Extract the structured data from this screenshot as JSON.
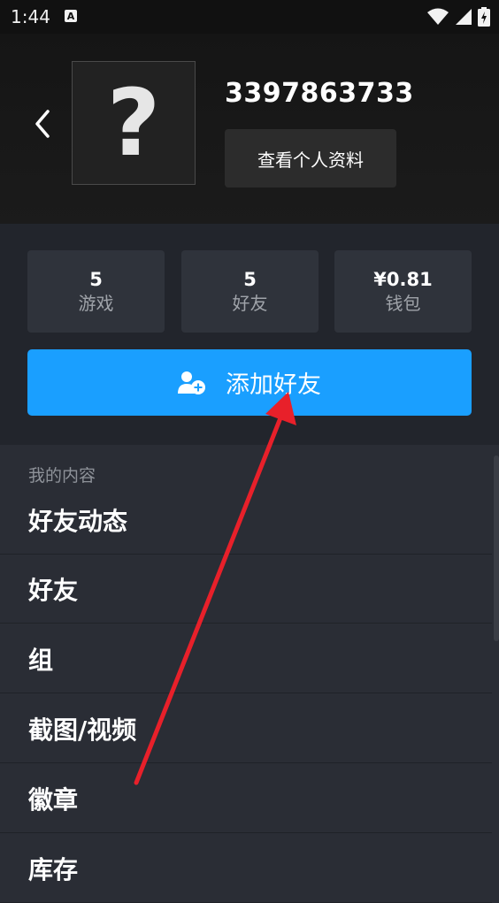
{
  "status_bar": {
    "time": "1:44",
    "app_icon_letter": "A",
    "icons": [
      "wifi-icon",
      "signal-icon",
      "battery-icon"
    ]
  },
  "profile": {
    "avatar_placeholder": "?",
    "username": "3397863733",
    "view_profile_label": "查看个人资料"
  },
  "stats": [
    {
      "value": "5",
      "label": "游戏"
    },
    {
      "value": "5",
      "label": "好友"
    },
    {
      "value": "¥0.81",
      "label": "钱包"
    }
  ],
  "add_friend": {
    "label": "添加好友",
    "icon": "add-user-icon"
  },
  "my_content": {
    "section_label": "我的内容",
    "items": [
      {
        "label": "好友动态"
      },
      {
        "label": "好友"
      },
      {
        "label": "组"
      },
      {
        "label": "截图/视频"
      },
      {
        "label": "徽章"
      },
      {
        "label": "库存"
      }
    ]
  },
  "colors": {
    "accent": "#1a9fff",
    "annotation_arrow": "#e8202a",
    "background": "#2a2d35"
  }
}
